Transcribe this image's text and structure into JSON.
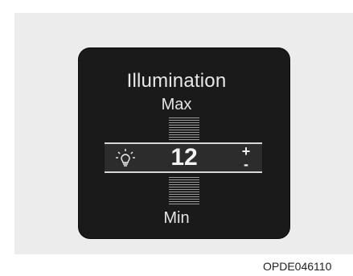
{
  "title": "Illumination",
  "scale": {
    "max_label": "Max",
    "min_label": "Min"
  },
  "illumination_level": "12",
  "controls": {
    "increase": "+",
    "decrease": "-"
  },
  "image_code": "OPDE046110",
  "icon": "illumination-bulb-icon",
  "colors": {
    "panel": "#1a1a1a",
    "text": "#e8e8e8",
    "frame": "#ececec"
  }
}
